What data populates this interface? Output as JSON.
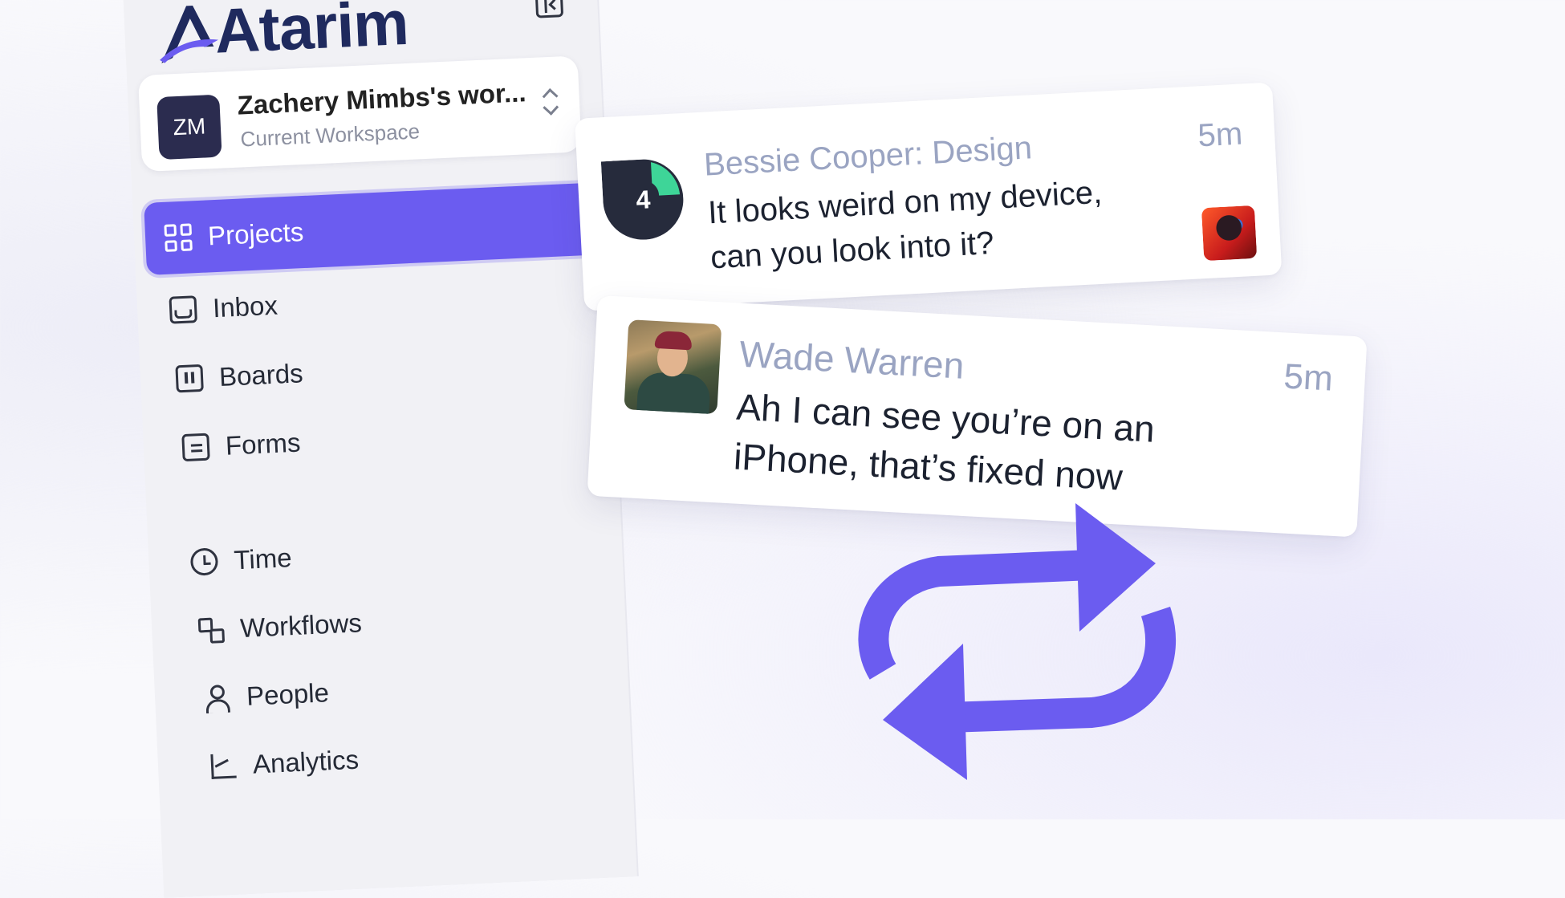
{
  "brand": {
    "name": "Atarim",
    "primary_color": "#6b5cf0",
    "logo_text_color": "#1f2a5e"
  },
  "sidebar": {
    "collapse_icon": "sidebar-collapse-icon",
    "workspace": {
      "initials": "ZM",
      "name": "Zachery Mimbs's wor...",
      "subtitle": "Current Workspace"
    },
    "nav": [
      {
        "label": "Projects",
        "icon": "grid-icon",
        "active": true
      },
      {
        "label": "Inbox",
        "icon": "inbox-icon"
      },
      {
        "label": "Boards",
        "icon": "board-icon"
      },
      {
        "label": "Forms",
        "icon": "form-icon"
      },
      {
        "label": "Time",
        "icon": "clock-icon"
      },
      {
        "label": "Workflows",
        "icon": "workflow-icon"
      },
      {
        "label": "People",
        "icon": "person-icon"
      },
      {
        "label": "Analytics",
        "icon": "chart-icon"
      }
    ]
  },
  "messages": [
    {
      "badge_count": "4",
      "sender": "Bessie Cooper: Design",
      "text": "It looks weird on my device, can you look into it?",
      "time": "5m"
    },
    {
      "sender": "Wade Warren",
      "text": "Ah I can see you’re on an iPhone, that’s fixed now",
      "time": "5m"
    }
  ],
  "decor": {
    "repeat_icon": "repeat-arrows-icon",
    "repeat_color": "#6b5cf0"
  }
}
